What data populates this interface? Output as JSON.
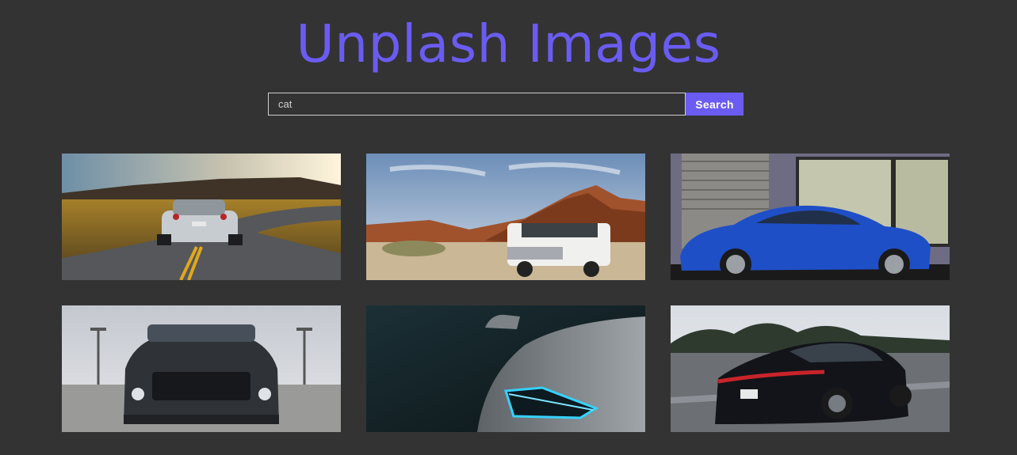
{
  "header": {
    "title": "Unplash Images"
  },
  "search": {
    "value": "cat",
    "button_label": "Search"
  },
  "gallery": {
    "images": [
      {
        "subject": "silver sports car on winding road at sunset"
      },
      {
        "subject": "white SUV in red rock desert"
      },
      {
        "subject": "blue coupe beside garage doors"
      },
      {
        "subject": "dark grey muscle car front view"
      },
      {
        "subject": "white car headlight close-up in dark"
      },
      {
        "subject": "black sports sedan on highway"
      }
    ]
  },
  "colors": {
    "background": "#333333",
    "accent": "#6a5cf2",
    "input_border": "#cfcfcf"
  }
}
